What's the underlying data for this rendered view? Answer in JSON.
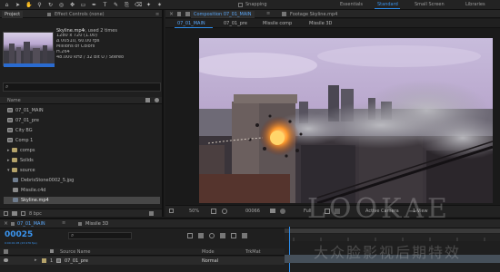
{
  "toolbar": {
    "tools": [
      "home-icon",
      "arrow-icon",
      "hand-icon",
      "zoom-icon",
      "rotate-icon",
      "camera-icon",
      "pan-behind-icon",
      "rectangle-icon",
      "pen-icon",
      "type-icon",
      "brush-icon",
      "clone-icon",
      "eraser-icon",
      "roto-icon",
      "puppet-icon"
    ],
    "snapping_label": "Snapping",
    "workspaces": [
      "Essentials",
      "Standard",
      "Small Screen",
      "Libraries"
    ],
    "active_workspace": "Standard",
    "accent": "#2d8ceb"
  },
  "project": {
    "tab_project": "Project",
    "tab_effect_controls": "Effect Controls (none)",
    "selected_file": "Skyline.mp4",
    "used_times": "▾, used 2 times",
    "info": [
      "1280 x 720 (1.00)",
      "Δ 00510, 60.00 fps",
      "Millions of Colors",
      "H.264",
      "48.000 kHz / 32 bit U / Stereo"
    ],
    "search_placeholder": "",
    "column_name": "Name",
    "items": [
      {
        "label": "07_01_MAIN",
        "type": "comp",
        "indent": 0
      },
      {
        "label": "07_01_pre",
        "type": "comp",
        "indent": 0
      },
      {
        "label": "City BG",
        "type": "comp",
        "indent": 0
      },
      {
        "label": "Comp 1",
        "type": "comp",
        "indent": 0
      },
      {
        "label": "comps",
        "type": "folder",
        "indent": 0
      },
      {
        "label": "Solids",
        "type": "folder",
        "indent": 0
      },
      {
        "label": "source",
        "type": "folder",
        "indent": 0
      },
      {
        "label": "DebrisStone0002_5.jpg",
        "type": "img",
        "indent": 1
      },
      {
        "label": "Missile.c4d",
        "type": "file",
        "indent": 1
      },
      {
        "label": "Skyline.mp4",
        "type": "video",
        "indent": 1,
        "selected": true
      }
    ],
    "bpc": "8 bpc"
  },
  "composition": {
    "tab_comp": "Composition 07_01_MAIN",
    "tab_footage": "Footage Skyline.mp4",
    "subtabs": [
      "07_01_MAIN",
      "07_01_pre",
      "Missile comp",
      "Missile 3D"
    ],
    "active_subtab": "07_01_MAIN"
  },
  "viewer_bar": {
    "zoom": "50%",
    "timecode": "00066",
    "resolution": "Full",
    "camera": "Active Camera",
    "view": "1 View"
  },
  "timeline": {
    "tabs": [
      "07_01_MAIN",
      "Missile 3D"
    ],
    "active_tab": "07_01_MAIN",
    "current_time": "00025",
    "time_sub": "0:00:01:05 (23.976 fps)",
    "col_source": "Source Name",
    "col_mode": "Mode",
    "col_trkmat": "TrkMat",
    "layer_num": "1",
    "layer_name": "07_01_pre",
    "layer_mode": "Normal"
  },
  "watermark": {
    "brand": "LOOKAE",
    "chinese": "大众脸影视后期特效"
  }
}
